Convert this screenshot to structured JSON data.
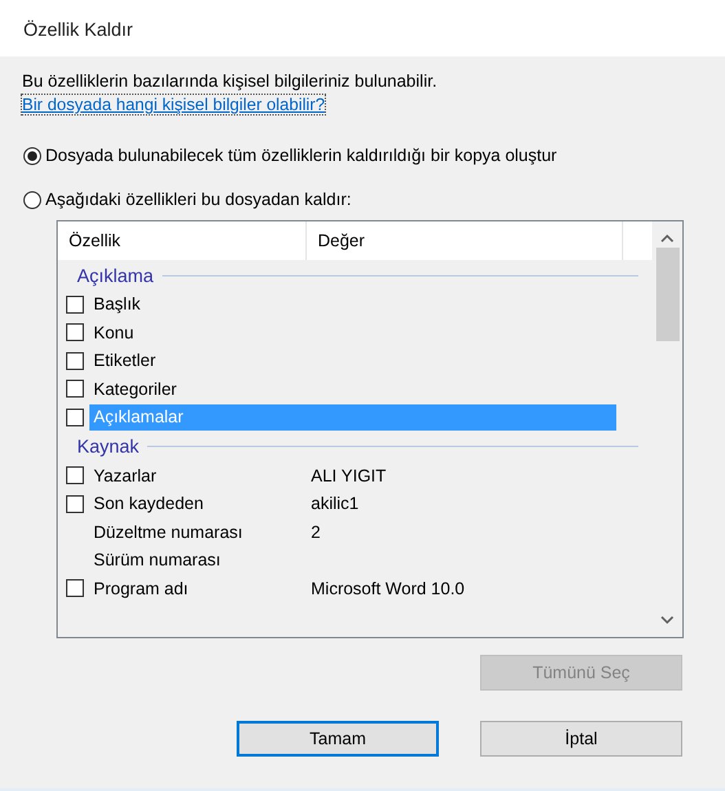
{
  "window": {
    "title": "Özellik Kaldır"
  },
  "info": "Bu özelliklerin bazılarında kişisel bilgileriniz bulunabilir.",
  "link": "Bir dosyada hangi kişisel bilgiler olabilir?",
  "options": [
    {
      "label": "Dosyada bulunabilecek tüm özelliklerin kaldırıldığı bir kopya oluştur",
      "selected": true
    },
    {
      "label": "Aşağıdaki özellikleri bu dosyadan kaldır:",
      "selected": false
    }
  ],
  "list": {
    "columns": [
      "Özellik",
      "Değer"
    ],
    "rows": [
      {
        "kind": "group",
        "label": "Açıklama"
      },
      {
        "kind": "check",
        "name": "Başlık",
        "checked": false,
        "selected": false
      },
      {
        "kind": "check",
        "name": "Konu",
        "checked": false,
        "selected": false
      },
      {
        "kind": "check",
        "name": "Etiketler",
        "checked": false,
        "selected": false
      },
      {
        "kind": "check",
        "name": "Kategoriler",
        "checked": false,
        "selected": false
      },
      {
        "kind": "check",
        "name": "Açıklamalar",
        "checked": false,
        "selected": true
      },
      {
        "kind": "group",
        "label": "Kaynak"
      },
      {
        "kind": "check",
        "name": "Yazarlar",
        "value": "ALI YIGIT",
        "checked": false,
        "selected": false
      },
      {
        "kind": "check",
        "name": "Son kaydeden",
        "value": "akilic1",
        "checked": false,
        "selected": false
      },
      {
        "kind": "plain",
        "name": "Düzeltme numarası",
        "value": "2",
        "selected": false
      },
      {
        "kind": "plain",
        "name": "Sürüm numarası",
        "selected": false
      },
      {
        "kind": "check",
        "name": "Program adı",
        "value": "Microsoft Word 10.0",
        "checked": false,
        "selected": false
      }
    ]
  },
  "select_all": {
    "label": "Tümünü Seç",
    "disabled": true
  },
  "buttons": [
    {
      "label": "Tamam",
      "focused": true
    },
    {
      "label": "İptal",
      "focused": false
    }
  ]
}
